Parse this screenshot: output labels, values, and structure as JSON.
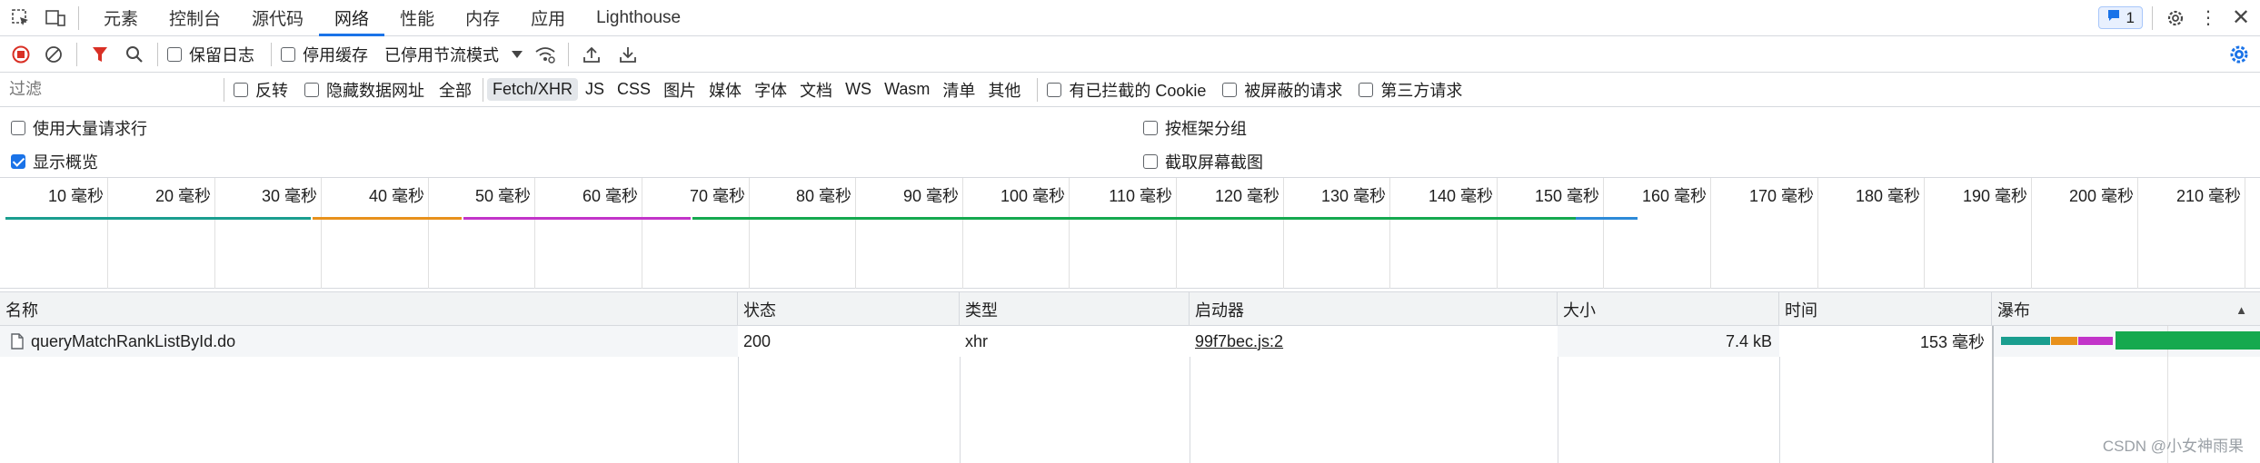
{
  "toolbar": {
    "tabs": [
      "元素",
      "控制台",
      "源代码",
      "网络",
      "性能",
      "内存",
      "应用",
      "Lighthouse"
    ],
    "active_tab": "网络",
    "issues_count": "1"
  },
  "network_toolbar": {
    "preserve_log": "保留日志",
    "disable_cache": "停用缓存",
    "throttling": "已停用节流模式"
  },
  "filter_bar": {
    "filter_placeholder": "过滤",
    "invert": "反转",
    "hide_data_urls": "隐藏数据网址",
    "types": [
      "全部",
      "Fetch/XHR",
      "JS",
      "CSS",
      "图片",
      "媒体",
      "字体",
      "文档",
      "WS",
      "Wasm",
      "清单",
      "其他"
    ],
    "selected_type": "Fetch/XHR",
    "blocked_cookies": "有已拦截的 Cookie",
    "blocked_requests": "被屏蔽的请求",
    "third_party": "第三方请求"
  },
  "settings": {
    "large_rows": "使用大量请求行",
    "group_by_frame": "按框架分组",
    "show_overview": "显示概览",
    "capture_screenshots": "截取屏幕截图"
  },
  "timeline": {
    "ticks": [
      "10 毫秒",
      "20 毫秒",
      "30 毫秒",
      "40 毫秒",
      "50 毫秒",
      "60 毫秒",
      "70 毫秒",
      "80 毫秒",
      "90 毫秒",
      "100 毫秒",
      "110 毫秒",
      "120 毫秒",
      "130 毫秒",
      "140 毫秒",
      "150 毫秒",
      "160 毫秒",
      "170 毫秒",
      "180 毫秒",
      "190 毫秒",
      "200 毫秒",
      "210 毫秒"
    ],
    "colors": {
      "teal": "#1a9e8f",
      "orange": "#e8911c",
      "magenta": "#c234c9",
      "green": "#15a94f",
      "blue": "#2d8ad8"
    }
  },
  "table": {
    "headers": [
      "名称",
      "状态",
      "类型",
      "启动器",
      "大小",
      "时间",
      "瀑布"
    ],
    "rows": [
      {
        "name": "queryMatchRankListById.do",
        "status": "200",
        "type": "xhr",
        "initiator": "99f7bec.js:2",
        "size": "7.4 kB",
        "time": "153 毫秒"
      }
    ]
  },
  "watermark": "CSDN @小女神雨果"
}
